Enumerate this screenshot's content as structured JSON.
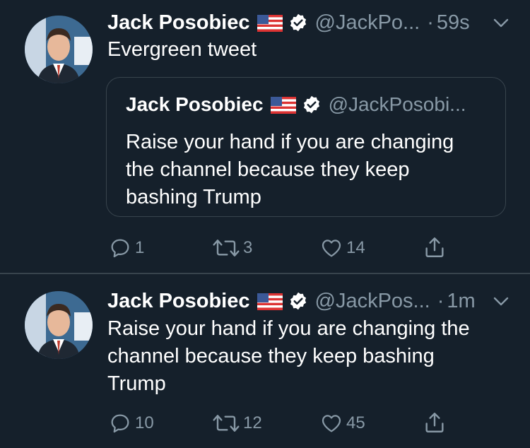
{
  "tweets": [
    {
      "name": "Jack Posobiec",
      "handle": "@JackPo...",
      "dot": "·",
      "time": "59s",
      "text": "Evergreen tweet",
      "quote": {
        "name": "Jack Posobiec",
        "handle": "@JackPosobi...",
        "text": "Raise your hand if you are changing\nthe channel because they keep\nbashing Trump"
      },
      "replies": "1",
      "retweets": "3",
      "likes": "14"
    },
    {
      "name": "Jack Posobiec",
      "handle": "@JackPos...",
      "dot": "·",
      "time": "1m",
      "text": "Raise your hand if you are changing the\nchannel because they keep bashing\nTrump",
      "replies": "10",
      "retweets": "12",
      "likes": "45"
    }
  ],
  "colors": {
    "background": "#15202b",
    "secondary_text": "#8899a6",
    "border": "#38444d",
    "verified": "#ffffff"
  },
  "icons": [
    "reply-icon",
    "retweet-icon",
    "like-icon",
    "share-icon",
    "verified-icon",
    "us-flag-icon",
    "caret-down-icon"
  ]
}
